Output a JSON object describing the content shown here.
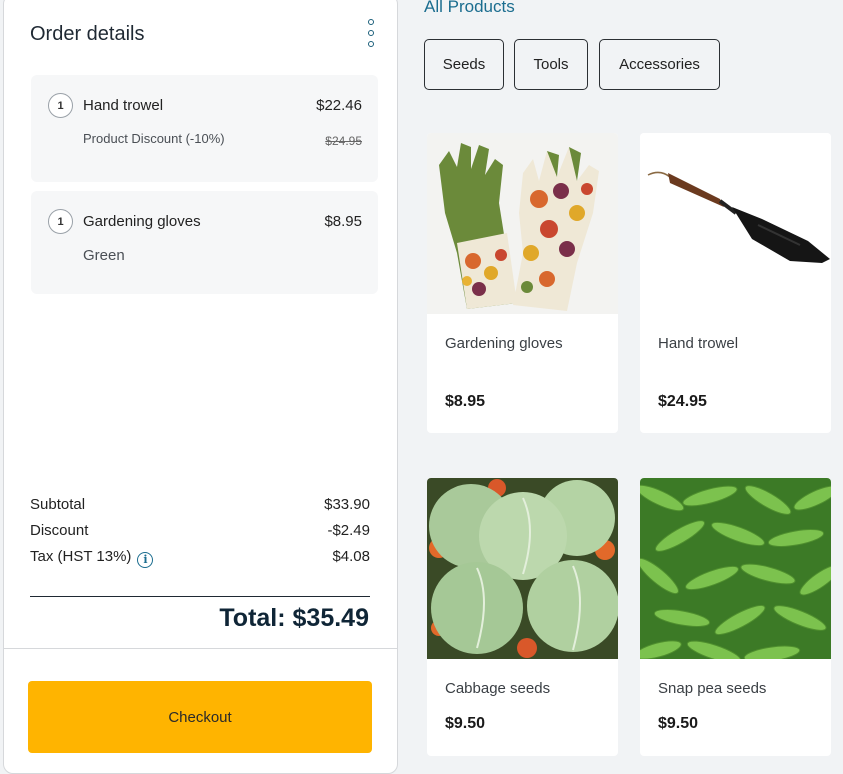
{
  "order": {
    "title": "Order details",
    "items": [
      {
        "qty": "1",
        "name": "Hand trowel",
        "price": "$22.46",
        "detail": "Product Discount (-10%)",
        "original_price": "$24.95"
      },
      {
        "qty": "1",
        "name": "Gardening gloves",
        "price": "$8.95",
        "detail": "Green"
      }
    ],
    "summary": {
      "subtotal_label": "Subtotal",
      "subtotal": "$33.90",
      "discount_label": "Discount",
      "discount": "-$2.49",
      "tax_label": "Tax (HST 13%)",
      "tax": "$4.08",
      "total": "Total: $35.49"
    },
    "checkout_label": "Checkout"
  },
  "catalog": {
    "heading": "All Products",
    "filters": [
      "Seeds",
      "Tools",
      "Accessories"
    ],
    "products": [
      {
        "name": "Gardening gloves",
        "price": "$8.95",
        "image": "gardening-gloves"
      },
      {
        "name": "Hand trowel",
        "price": "$24.95",
        "image": "hand-trowel"
      },
      {
        "name": "Cabbage seeds",
        "price": "$9.50",
        "image": "cabbage-heads"
      },
      {
        "name": "Snap pea seeds",
        "price": "$9.50",
        "image": "snap-peas"
      }
    ]
  },
  "colors": {
    "accent": "#1b6d8f",
    "checkout": "#ffb400",
    "glove_green": "#6b8a3a",
    "cabbage": "#a9c99a",
    "pea": "#6cb243"
  }
}
